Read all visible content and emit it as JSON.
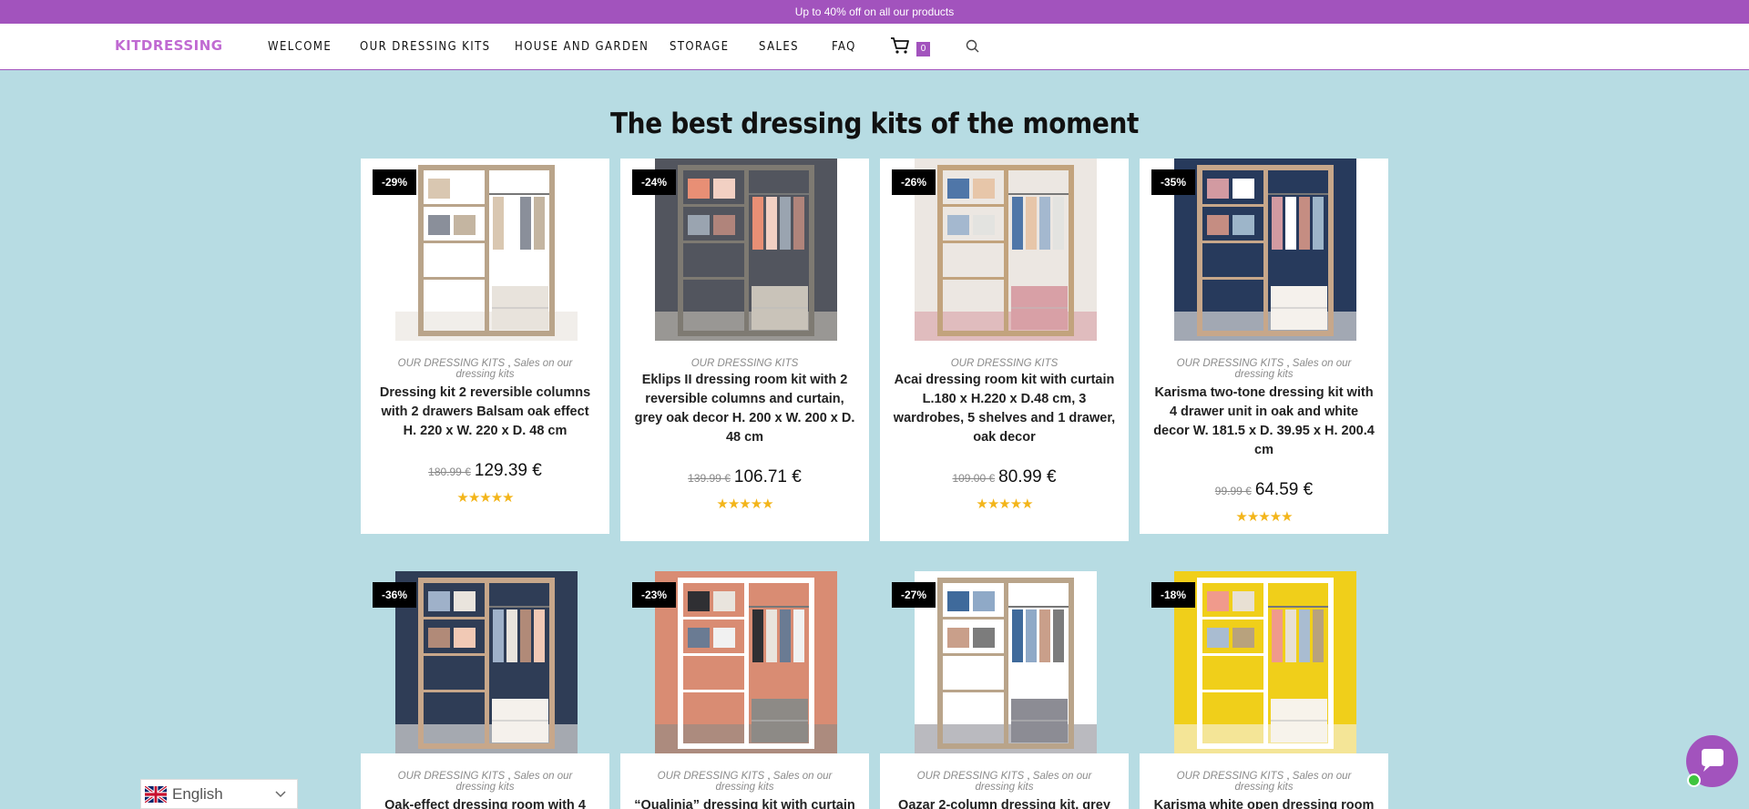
{
  "promo": {
    "text": "Up to 40% off on all our products"
  },
  "header": {
    "logo": "KITDRESSING",
    "nav": [
      "WELCOME",
      "OUR DRESSING KITS",
      "HOUSE AND GARDEN",
      "STORAGE",
      "SALES",
      "FAQ"
    ],
    "cart_count": "0",
    "cart_icon": "cart-icon",
    "search_icon": "search-icon"
  },
  "section": {
    "title": "The best dressing kits of the moment"
  },
  "products": [
    {
      "discount": "-29%",
      "cat1": "OUR DRESSING KITS",
      "sep": " , ",
      "cat2": "Sales on our dressing kits",
      "title": "Dressing kit 2 reversible columns with 2 drawers Balsam oak effect H. 220 x W. 220 x D. 48 cm",
      "old_price": "180.99 €",
      "price": "129.39 €",
      "rating": "★★★★★"
    },
    {
      "discount": "-24%",
      "cat1": "OUR DRESSING KITS",
      "sep": "",
      "cat2": "",
      "title": "Eklips II dressing room kit with 2 reversible columns and curtain, grey oak decor H. 200 x W. 200 x D. 48 cm",
      "old_price": "139.99 €",
      "price": "106.71 €",
      "rating": "★★★★★"
    },
    {
      "discount": "-26%",
      "cat1": "OUR DRESSING KITS",
      "sep": "",
      "cat2": "",
      "title": "Acai dressing room kit with curtain L.180 x H.220 x D.48 cm, 3 wardrobes, 5 shelves and 1 drawer, oak decor",
      "old_price": "109.00 €",
      "price": "80.99 €",
      "rating": "★★★★★"
    },
    {
      "discount": "-35%",
      "cat1": "OUR DRESSING KITS",
      "sep": " , ",
      "cat2": "Sales on our dressing kits",
      "title": "Karisma two-tone dressing kit with 4 drawer unit in oak and white decor W. 181.5 x D. 39.95 x H. 200.4 cm",
      "old_price": "99.99 €",
      "price": "64.59 €",
      "rating": "★★★★★"
    },
    {
      "discount": "-36%",
      "cat1": "OUR DRESSING KITS",
      "sep": " , ",
      "cat2": "Sales on our dressing kits",
      "title": "Oak-effect dressing room with 4",
      "old_price": "",
      "price": "",
      "rating": ""
    },
    {
      "discount": "-23%",
      "cat1": "OUR DRESSING KITS",
      "sep": " , ",
      "cat2": "Sales on our dressing kits",
      "title": "“Qualinia” dressing kit with curtain",
      "old_price": "",
      "price": "",
      "rating": ""
    },
    {
      "discount": "-27%",
      "cat1": "OUR DRESSING KITS",
      "sep": " , ",
      "cat2": "Sales on our dressing kits",
      "title": "Qazar 2-column dressing kit, grey",
      "old_price": "",
      "price": "",
      "rating": ""
    },
    {
      "discount": "-18%",
      "cat1": "OUR DRESSING KITS",
      "sep": " , ",
      "cat2": "Sales on our dressing kits",
      "title": "Karisma white open dressing room",
      "old_price": "",
      "price": "",
      "rating": ""
    }
  ],
  "language": {
    "label": "English",
    "flag_icon": "uk-flag-icon",
    "chevron_icon": "chevron-down-icon"
  },
  "chat": {
    "icon": "chat-bubble-icon",
    "status_color": "#3ec53e"
  },
  "colors": {
    "accent": "#a253bd",
    "background": "#b7dce3",
    "star": "#f3b51a"
  }
}
